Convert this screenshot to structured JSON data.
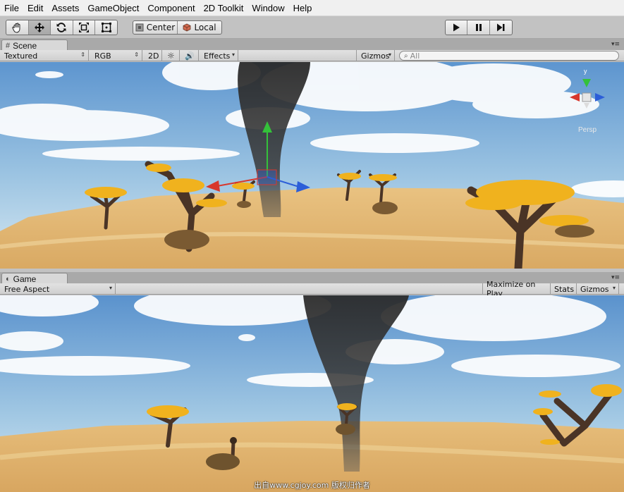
{
  "menu": {
    "items": [
      "File",
      "Edit",
      "Assets",
      "GameObject",
      "Component",
      "2D Toolkit",
      "Window",
      "Help"
    ]
  },
  "toolbar": {
    "transform_tools": [
      "hand-icon",
      "move-icon",
      "rotate-icon",
      "scale-icon",
      "rect-icon"
    ],
    "pivot_label": "Center",
    "space_label": "Local",
    "play_controls": [
      "play-icon",
      "pause-icon",
      "step-icon"
    ]
  },
  "scene": {
    "tab_label": "Scene",
    "shading_mode": "Textured",
    "render_mode": "RGB",
    "mode_2d_label": "2D",
    "effects_label": "Effects",
    "gizmos_label": "Gizmos",
    "search_placeholder": "All",
    "gizmo_y_label": "y",
    "persp_label": "Persp"
  },
  "game": {
    "tab_label": "Game",
    "aspect_label": "Free Aspect",
    "maximize_label": "Maximize on Play",
    "stats_label": "Stats",
    "gizmos_label": "Gizmos"
  },
  "watermark": "出自www.cgjoy.com 版权归作者",
  "colors": {
    "editor_bg": "#c2c2c2",
    "sky_top": "#5d95cf",
    "sky_bottom": "#cfe3ef",
    "ground": "#e2b46e",
    "smoke": "#2e2e2e",
    "foliage": "#f0b21e",
    "trunk": "#4a3426",
    "gizmo_x": "#d8372c",
    "gizmo_y": "#34c13a",
    "gizmo_z": "#2c5ed8"
  }
}
